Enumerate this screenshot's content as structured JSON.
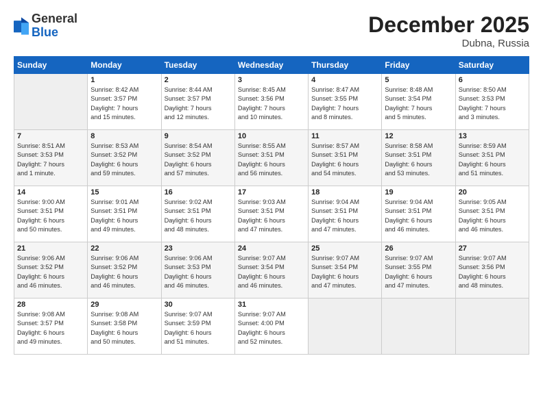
{
  "logo": {
    "general": "General",
    "blue": "Blue"
  },
  "title": "December 2025",
  "subtitle": "Dubna, Russia",
  "header_days": [
    "Sunday",
    "Monday",
    "Tuesday",
    "Wednesday",
    "Thursday",
    "Friday",
    "Saturday"
  ],
  "weeks": [
    [
      {
        "day": "",
        "info": ""
      },
      {
        "day": "1",
        "info": "Sunrise: 8:42 AM\nSunset: 3:57 PM\nDaylight: 7 hours\nand 15 minutes."
      },
      {
        "day": "2",
        "info": "Sunrise: 8:44 AM\nSunset: 3:57 PM\nDaylight: 7 hours\nand 12 minutes."
      },
      {
        "day": "3",
        "info": "Sunrise: 8:45 AM\nSunset: 3:56 PM\nDaylight: 7 hours\nand 10 minutes."
      },
      {
        "day": "4",
        "info": "Sunrise: 8:47 AM\nSunset: 3:55 PM\nDaylight: 7 hours\nand 8 minutes."
      },
      {
        "day": "5",
        "info": "Sunrise: 8:48 AM\nSunset: 3:54 PM\nDaylight: 7 hours\nand 5 minutes."
      },
      {
        "day": "6",
        "info": "Sunrise: 8:50 AM\nSunset: 3:53 PM\nDaylight: 7 hours\nand 3 minutes."
      }
    ],
    [
      {
        "day": "7",
        "info": "Sunrise: 8:51 AM\nSunset: 3:53 PM\nDaylight: 7 hours\nand 1 minute."
      },
      {
        "day": "8",
        "info": "Sunrise: 8:53 AM\nSunset: 3:52 PM\nDaylight: 6 hours\nand 59 minutes."
      },
      {
        "day": "9",
        "info": "Sunrise: 8:54 AM\nSunset: 3:52 PM\nDaylight: 6 hours\nand 57 minutes."
      },
      {
        "day": "10",
        "info": "Sunrise: 8:55 AM\nSunset: 3:51 PM\nDaylight: 6 hours\nand 56 minutes."
      },
      {
        "day": "11",
        "info": "Sunrise: 8:57 AM\nSunset: 3:51 PM\nDaylight: 6 hours\nand 54 minutes."
      },
      {
        "day": "12",
        "info": "Sunrise: 8:58 AM\nSunset: 3:51 PM\nDaylight: 6 hours\nand 53 minutes."
      },
      {
        "day": "13",
        "info": "Sunrise: 8:59 AM\nSunset: 3:51 PM\nDaylight: 6 hours\nand 51 minutes."
      }
    ],
    [
      {
        "day": "14",
        "info": "Sunrise: 9:00 AM\nSunset: 3:51 PM\nDaylight: 6 hours\nand 50 minutes."
      },
      {
        "day": "15",
        "info": "Sunrise: 9:01 AM\nSunset: 3:51 PM\nDaylight: 6 hours\nand 49 minutes."
      },
      {
        "day": "16",
        "info": "Sunrise: 9:02 AM\nSunset: 3:51 PM\nDaylight: 6 hours\nand 48 minutes."
      },
      {
        "day": "17",
        "info": "Sunrise: 9:03 AM\nSunset: 3:51 PM\nDaylight: 6 hours\nand 47 minutes."
      },
      {
        "day": "18",
        "info": "Sunrise: 9:04 AM\nSunset: 3:51 PM\nDaylight: 6 hours\nand 47 minutes."
      },
      {
        "day": "19",
        "info": "Sunrise: 9:04 AM\nSunset: 3:51 PM\nDaylight: 6 hours\nand 46 minutes."
      },
      {
        "day": "20",
        "info": "Sunrise: 9:05 AM\nSunset: 3:51 PM\nDaylight: 6 hours\nand 46 minutes."
      }
    ],
    [
      {
        "day": "21",
        "info": "Sunrise: 9:06 AM\nSunset: 3:52 PM\nDaylight: 6 hours\nand 46 minutes."
      },
      {
        "day": "22",
        "info": "Sunrise: 9:06 AM\nSunset: 3:52 PM\nDaylight: 6 hours\nand 46 minutes."
      },
      {
        "day": "23",
        "info": "Sunrise: 9:06 AM\nSunset: 3:53 PM\nDaylight: 6 hours\nand 46 minutes."
      },
      {
        "day": "24",
        "info": "Sunrise: 9:07 AM\nSunset: 3:54 PM\nDaylight: 6 hours\nand 46 minutes."
      },
      {
        "day": "25",
        "info": "Sunrise: 9:07 AM\nSunset: 3:54 PM\nDaylight: 6 hours\nand 47 minutes."
      },
      {
        "day": "26",
        "info": "Sunrise: 9:07 AM\nSunset: 3:55 PM\nDaylight: 6 hours\nand 47 minutes."
      },
      {
        "day": "27",
        "info": "Sunrise: 9:07 AM\nSunset: 3:56 PM\nDaylight: 6 hours\nand 48 minutes."
      }
    ],
    [
      {
        "day": "28",
        "info": "Sunrise: 9:08 AM\nSunset: 3:57 PM\nDaylight: 6 hours\nand 49 minutes."
      },
      {
        "day": "29",
        "info": "Sunrise: 9:08 AM\nSunset: 3:58 PM\nDaylight: 6 hours\nand 50 minutes."
      },
      {
        "day": "30",
        "info": "Sunrise: 9:07 AM\nSunset: 3:59 PM\nDaylight: 6 hours\nand 51 minutes."
      },
      {
        "day": "31",
        "info": "Sunrise: 9:07 AM\nSunset: 4:00 PM\nDaylight: 6 hours\nand 52 minutes."
      },
      {
        "day": "",
        "info": ""
      },
      {
        "day": "",
        "info": ""
      },
      {
        "day": "",
        "info": ""
      }
    ]
  ]
}
